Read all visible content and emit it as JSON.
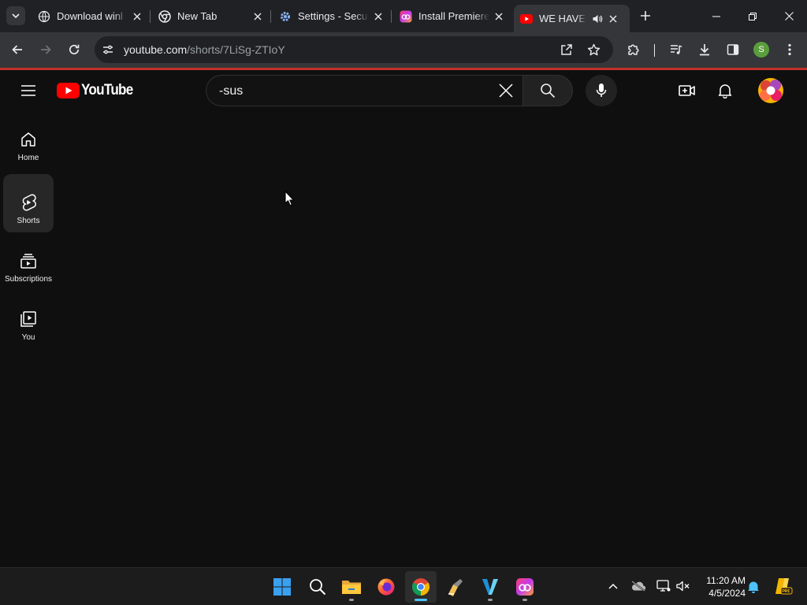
{
  "browser": {
    "tabs": [
      {
        "title": "Download winl",
        "active": false
      },
      {
        "title": "New Tab",
        "active": false
      },
      {
        "title": "Settings - Secu",
        "active": false
      },
      {
        "title": "Install Premiere",
        "active": false
      },
      {
        "title": "WE HAVE TO",
        "active": true
      }
    ],
    "url_host": "youtube.com",
    "url_path": "/shorts/7LiSg-ZTIoY",
    "profile_initial": "S"
  },
  "youtube": {
    "logo_text": "YouTube",
    "search_value": "-sus",
    "guide": [
      {
        "label": "Home",
        "icon": "home-icon",
        "active": false
      },
      {
        "label": "Shorts",
        "icon": "shorts-icon",
        "active": true
      },
      {
        "label": "Subscriptions",
        "icon": "subscriptions-icon",
        "active": false
      },
      {
        "label": "You",
        "icon": "you-icon",
        "active": false
      }
    ]
  },
  "taskbar": {
    "time": "11:20 AM",
    "date": "4/5/2024"
  },
  "colors": {
    "youtube_red": "#ff0000",
    "loading_bar": "#c4302b",
    "active_indicator": "#4cc2ff"
  }
}
